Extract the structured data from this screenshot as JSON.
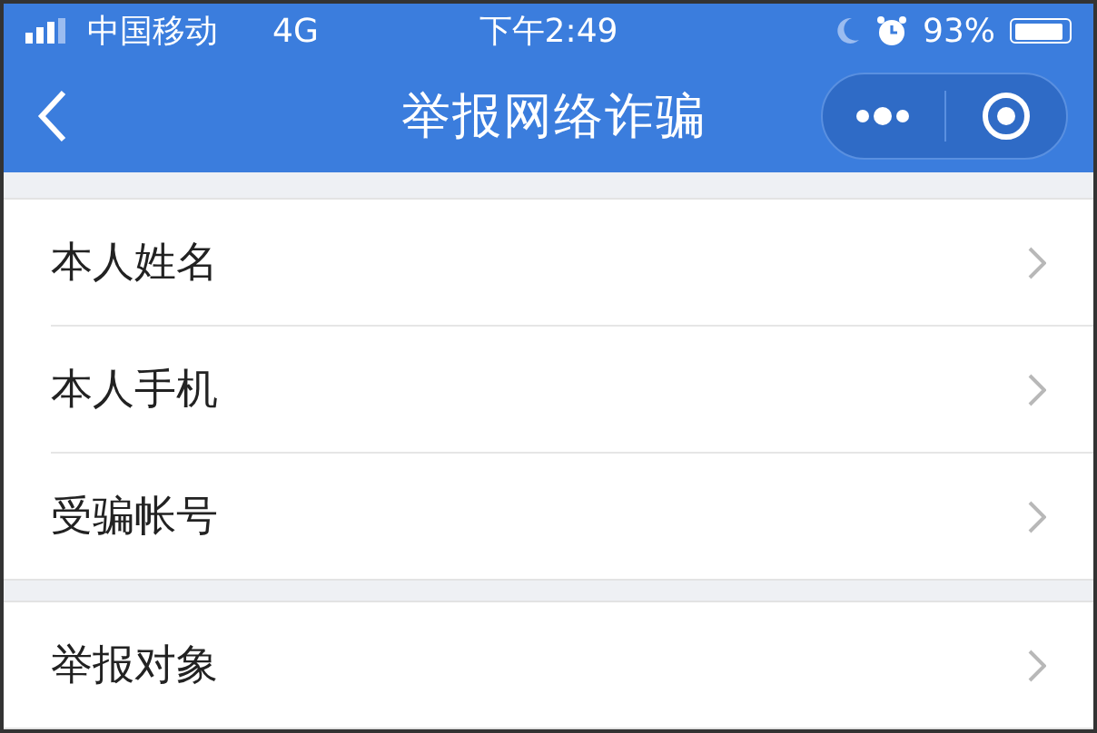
{
  "status_bar": {
    "carrier": "中国移动",
    "network": "4G",
    "time": "下午2:49",
    "battery": "93%"
  },
  "nav_bar": {
    "title": "举报网络诈骗"
  },
  "sections": [
    {
      "items": [
        {
          "label": "本人姓名"
        },
        {
          "label": "本人手机"
        },
        {
          "label": "受骗帐号"
        }
      ]
    },
    {
      "items": [
        {
          "label": "举报对象"
        }
      ]
    }
  ]
}
